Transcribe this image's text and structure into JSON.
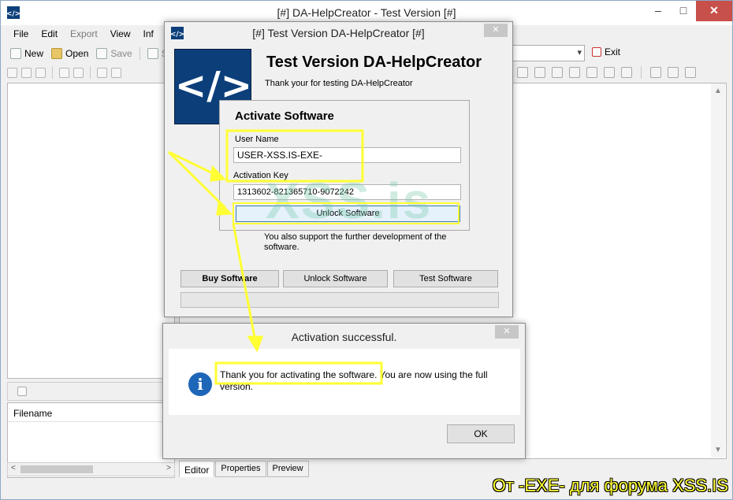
{
  "main_window": {
    "title": "[#] DA-HelpCreator - Test Version [#]",
    "menu": [
      "File",
      "Edit",
      "Export",
      "View",
      "Inf"
    ],
    "toolbar": {
      "new": "New",
      "open": "Open",
      "save": "Save",
      "s_cut": "S",
      "exit": "Exit"
    },
    "file_list_header": "Filename",
    "tabs": [
      "Editor",
      "Properties",
      "Preview"
    ]
  },
  "test_dialog": {
    "title": "[#] Test Version DA-HelpCreator [#]",
    "heading": "Test Version DA-HelpCreator",
    "thanks": "Thank your for testing DA-HelpCreator",
    "logo_text": "</>",
    "activation": {
      "heading": "Activate Software",
      "username_label": "User Name",
      "username_value": "USER-XSS.IS-EXE-",
      "key_label": "Activation Key",
      "key_value": "1313602-821365710-9072242",
      "unlock_button": "Unlock Software"
    },
    "support_text": "You  also support the further development of the software.",
    "buttons": {
      "buy": "Buy Software",
      "unlock": "Unlock Software",
      "test": "Test Software"
    }
  },
  "success_dialog": {
    "title": "Activation successful.",
    "message": "Thank you for activating the software. You are now using the full version.",
    "ok": "OK"
  },
  "annotations": {
    "watermark": "XSS.is",
    "footer_caption": "От -EXE- для форума XSS.IS",
    "highlight_color": "#ffff33"
  }
}
